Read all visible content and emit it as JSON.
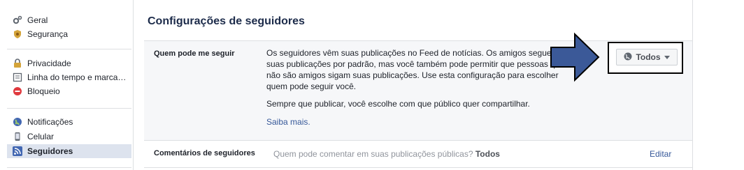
{
  "sidebar": {
    "groups": [
      [
        {
          "label": "Geral",
          "icon": "gears-icon"
        },
        {
          "label": "Segurança",
          "icon": "shield-icon"
        }
      ],
      [
        {
          "label": "Privacidade",
          "icon": "lock-icon"
        },
        {
          "label": "Linha do tempo e marca…",
          "icon": "timeline-icon"
        },
        {
          "label": "Bloqueio",
          "icon": "block-icon"
        }
      ],
      [
        {
          "label": "Notificações",
          "icon": "globe-icon"
        },
        {
          "label": "Celular",
          "icon": "mobile-icon"
        },
        {
          "label": "Seguidores",
          "icon": "rss-icon",
          "active": true
        }
      ]
    ]
  },
  "main": {
    "title": "Configurações de seguidores",
    "followers_row": {
      "label": "Quem pode me seguir",
      "description": "Os seguidores vêm suas publicações no Feed de notícias. Os amigos seguem suas publicações por padrão, mas você também pode permitir que pessoas que não são amigos sigam suas publicações. Use esta configuração para escolher quem pode seguir você.",
      "note": "Sempre que publicar, você escolhe com que público quer compartilhar.",
      "learn_more": "Saiba mais.",
      "audience_value": "Todos"
    },
    "comments_row": {
      "label": "Comentários de seguidores",
      "question": "Quem pode comentar em suas publicações públicas?",
      "value": "Todos",
      "edit_label": "Editar"
    }
  },
  "colors": {
    "accent": "#365899",
    "arrow_fill": "#3b5998",
    "active_bg": "#dde3ee"
  }
}
